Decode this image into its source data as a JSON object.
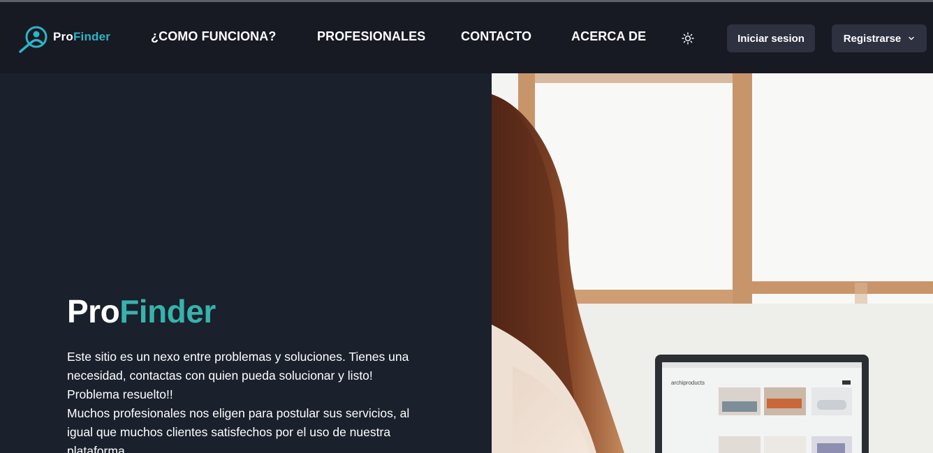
{
  "brand": {
    "pro": "Pro",
    "finder": "Finder"
  },
  "nav": {
    "links": [
      {
        "label": "¿COMO FUNCIONA?"
      },
      {
        "label": "PROFESIONALES"
      },
      {
        "label": "CONTACTO"
      },
      {
        "label": "ACERCA DE"
      }
    ],
    "theme_icon": "sun-icon",
    "login_label": "Iniciar sesion",
    "register_label": "Registrarse"
  },
  "hero": {
    "title_pro": "Pro",
    "title_finder": "Finder",
    "paragraph1": "Este sitio es un nexo entre problemas y soluciones. Tienes una necesidad, contactas con quien pueda solucionar y listo! Problema resuelto!!",
    "paragraph2": "Muchos profesionales nos eligen para postular sus servicios, al igual que muchos clientes satisfechos por el uso de nuestra plataforma",
    "image_caption": "archiproducts"
  },
  "colors": {
    "nav_bg": "#171923",
    "page_bg": "#1a202c",
    "accent": "#38b2ac",
    "logo_accent": "#2bb5c5",
    "button_bg": "#2d3140"
  }
}
